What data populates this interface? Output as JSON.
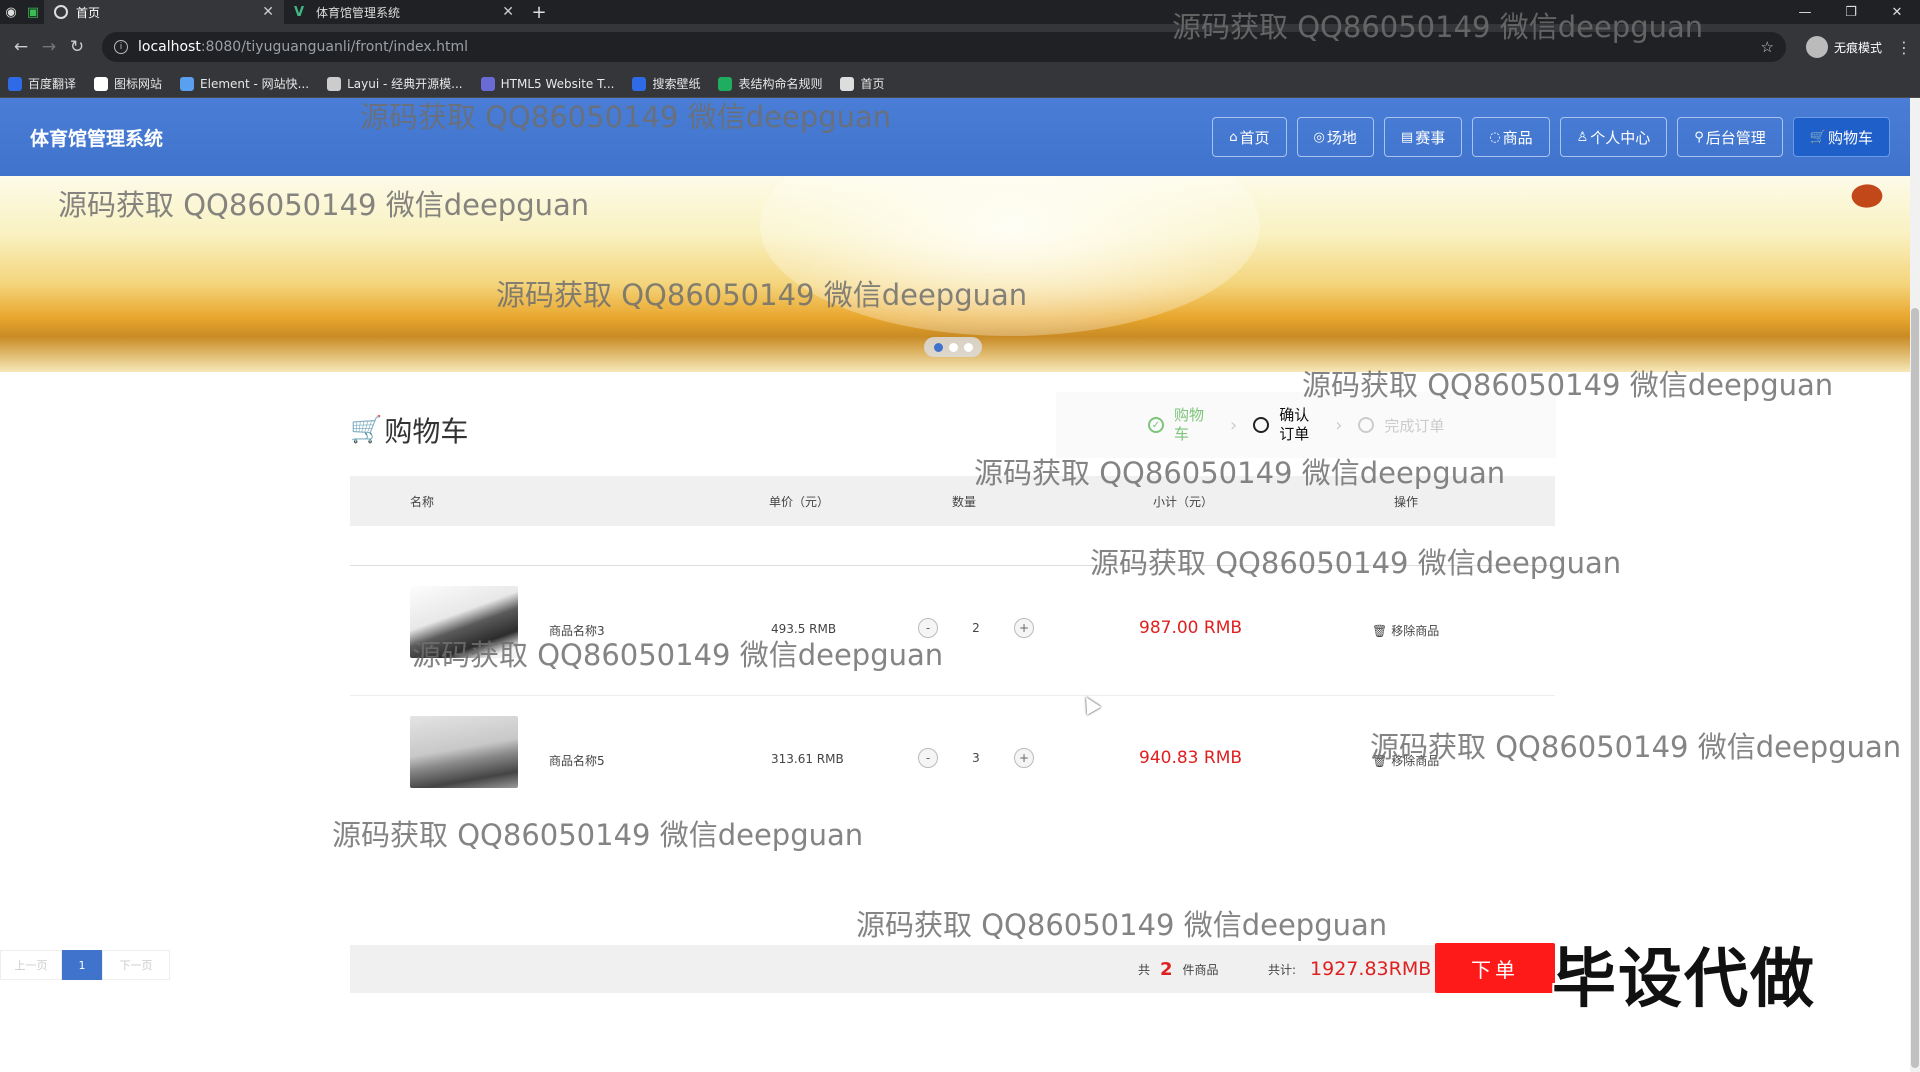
{
  "browser": {
    "tabs": [
      {
        "title": "首页",
        "active": true
      },
      {
        "title": "体育馆管理系统",
        "active": false
      }
    ],
    "new_tab": "+",
    "url_host": "localhost",
    "url_path": ":8080/tiyuguanguanli/front/index.html",
    "profile_label": "无痕模式",
    "bookmarks": [
      "百度翻译",
      "图标网站",
      "Element - 网站快...",
      "Layui - 经典开源模...",
      "HTML5 Website T...",
      "搜索壁纸",
      "表结构命名规则",
      "首页"
    ],
    "bookmark_colors": [
      "#2f6be7",
      "#ffffff",
      "#5aa0f0",
      "#cccccc",
      "#6b6bd6",
      "#2f6be7",
      "#1fae5f",
      "#dddddd"
    ]
  },
  "site": {
    "title": "体育馆管理系统",
    "nav": [
      {
        "icon": "⌂",
        "label": "首页"
      },
      {
        "icon": "◎",
        "label": "场地"
      },
      {
        "icon": "▤",
        "label": "赛事"
      },
      {
        "icon": "◌",
        "label": "商品"
      },
      {
        "icon": "♙",
        "label": "个人中心"
      },
      {
        "icon": "⚲",
        "label": "后台管理"
      },
      {
        "icon": "🛒",
        "label": "购物车"
      }
    ],
    "accent_color": "#3f73cc"
  },
  "cart": {
    "title": "购物车",
    "steps": [
      {
        "label": "购物车",
        "state": "done"
      },
      {
        "label": "确认订单",
        "state": "current"
      },
      {
        "label": "完成订单",
        "state": "todo"
      }
    ],
    "columns": [
      "名称",
      "单价（元）",
      "数量",
      "小计（元）",
      "操作"
    ],
    "items": [
      {
        "name": "商品名称3",
        "price": "493.5 RMB",
        "qty": "2",
        "subtotal": "987.00 RMB",
        "action": "移除商品"
      },
      {
        "name": "商品名称5",
        "price": "313.61 RMB",
        "qty": "3",
        "subtotal": "940.83 RMB",
        "action": "移除商品"
      }
    ],
    "minus": "-",
    "plus": "+",
    "summary": {
      "prefix": "共",
      "count": "2",
      "suffix": "件商品",
      "total_label": "共计:",
      "total": "1927.83RMB",
      "order_button": "下单"
    }
  },
  "pager": {
    "prev": "上一页",
    "current": "1",
    "next": "下一页"
  },
  "overlay": {
    "watermark": "源码获取 QQ86050149 微信deepguan",
    "stamp": "毕设代做"
  }
}
